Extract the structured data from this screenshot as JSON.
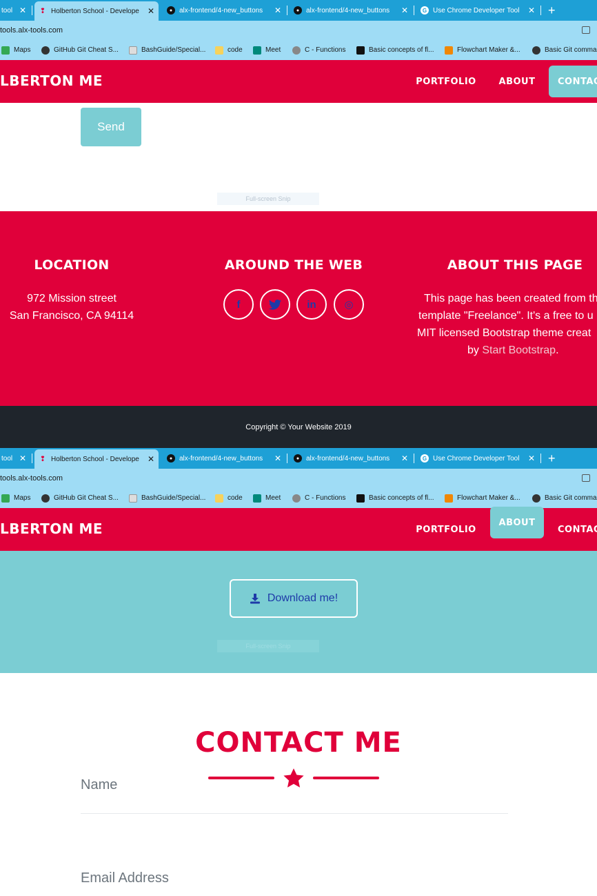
{
  "browser": {
    "tabs": [
      {
        "title": "tool",
        "favicon": "tool-icon",
        "active": false
      },
      {
        "title": "Holberton School - Develope",
        "favicon": "holberton-icon",
        "active": true
      },
      {
        "title": "alx-frontend/4-new_buttons",
        "favicon": "github-icon",
        "active": false
      },
      {
        "title": "alx-frontend/4-new_buttons",
        "favicon": "github-icon",
        "active": false
      },
      {
        "title": "Use Chrome Developer Tool",
        "favicon": "chrome-icon",
        "active": false
      }
    ],
    "close_glyph": "✕",
    "new_tab_glyph": "+",
    "url": "tools.alx-tools.com",
    "bookmarks": [
      {
        "label": "Maps",
        "color": "#34a853"
      },
      {
        "label": "GitHub Git Cheat S...",
        "color": "#333333"
      },
      {
        "label": "BashGuide/Special...",
        "color": "#dddddd"
      },
      {
        "label": "code",
        "color": "#f6d25c"
      },
      {
        "label": "Meet",
        "color": "#00897b"
      },
      {
        "label": "C - Functions",
        "color": "#888888"
      },
      {
        "label": "Basic concepts of fl...",
        "color": "#111111"
      },
      {
        "label": "Flowchart Maker &...",
        "color": "#f08705"
      },
      {
        "label": "Basic Git comma",
        "color": "#333333"
      }
    ]
  },
  "site": {
    "brand": "HOLBERTON ME",
    "brand_visible": "LBERTON ME",
    "nav": {
      "portfolio": "PORTFOLIO",
      "about": "ABOUT",
      "contact": "CONTACT",
      "contact_visible": "CONTAC"
    }
  },
  "form_top": {
    "send": "Send",
    "snip": "Full-screen Snip"
  },
  "footer": {
    "location_title": "LOCATION",
    "address_line1": "972 Mission street",
    "address_line2": "San Francisco, CA 94114",
    "web_title": "AROUND THE WEB",
    "social": [
      {
        "name": "facebook-icon",
        "glyph": "f"
      },
      {
        "name": "twitter-icon",
        "glyph": "t"
      },
      {
        "name": "linkedin-icon",
        "glyph": "in"
      },
      {
        "name": "dribbble-icon",
        "glyph": "◎"
      }
    ],
    "about_title": "ABOUT THIS PAGE",
    "about_line1": "This page has been created from th",
    "about_line2": "template \"Freelance\". It's a free to u",
    "about_line3": "MIT licensed Bootstrap theme creat",
    "about_by": "by ",
    "about_link": "Start Bootstrap",
    "about_end": ".",
    "copyright": "Copyright © Your Website 2019"
  },
  "second": {
    "download": "Download me!",
    "snip": "Full-screen Snip",
    "contact_title": "CONTACT ME",
    "name_label": "Name",
    "email_label": "Email Address"
  },
  "colors": {
    "primary": "#e0003a",
    "teal": "#7bcdd3",
    "dark": "#1f252c",
    "link_blue": "#1e3aa8"
  }
}
